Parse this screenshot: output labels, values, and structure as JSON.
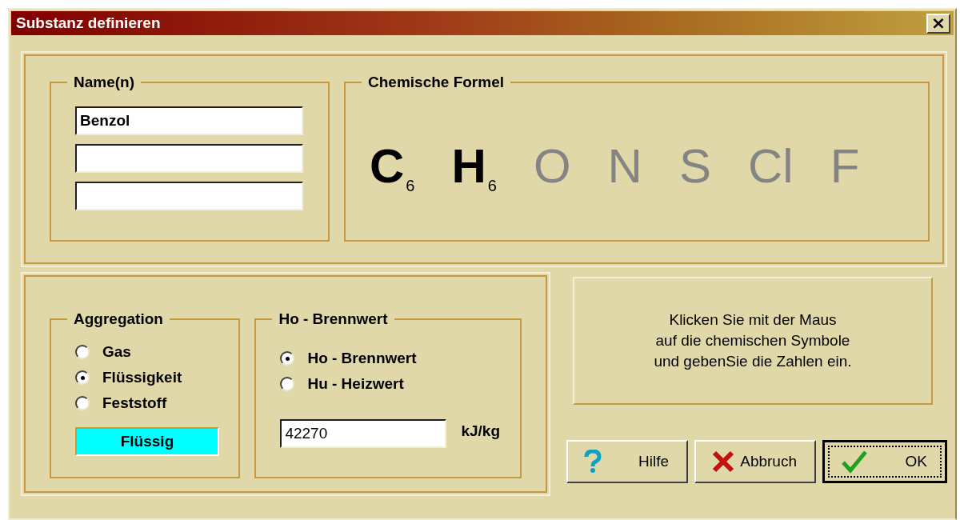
{
  "window": {
    "title": "Substanz definieren",
    "close": "×"
  },
  "names": {
    "label": "Name(n)",
    "fields": [
      {
        "kind": "text",
        "value": "Benzol"
      },
      {
        "kind": "blank"
      },
      {
        "kind": "blank"
      }
    ]
  },
  "formula": {
    "label": "Chemische Formel",
    "elements": [
      {
        "symbol": "C",
        "subscript": "6",
        "active": true
      },
      {
        "symbol": "H",
        "subscript": "6",
        "active": true
      },
      {
        "symbol": "O",
        "active": false
      },
      {
        "symbol": "N",
        "active": false
      },
      {
        "symbol": "S",
        "active": false
      },
      {
        "symbol": "Cl",
        "active": false
      },
      {
        "symbol": "F",
        "active": false
      }
    ]
  },
  "aggregation": {
    "label": "Aggregation",
    "options": [
      {
        "label": "Gas",
        "selected": false
      },
      {
        "label": "Flüssigkeit",
        "selected": true
      },
      {
        "label": "Feststoff",
        "selected": false
      }
    ],
    "state": {
      "label": "Flüssig",
      "color": "#00ffff"
    }
  },
  "heating_value": {
    "label": "Ho - Brennwert",
    "options": [
      {
        "label": "Ho - Brennwert",
        "selected": true
      },
      {
        "label": "Hu - Heizwert",
        "selected": false
      }
    ],
    "value": "42270",
    "unit": "kJ/kg"
  },
  "hint": "Klicken Sie mit der Maus\nauf die chemischen Symbole\nund gebenSie die Zahlen ein.",
  "buttons": [
    {
      "label": "Hilfe",
      "kind": "help",
      "default": false
    },
    {
      "label": "Abbruch",
      "kind": "cancel",
      "default": false
    },
    {
      "label": "OK",
      "kind": "ok",
      "default": true
    }
  ]
}
